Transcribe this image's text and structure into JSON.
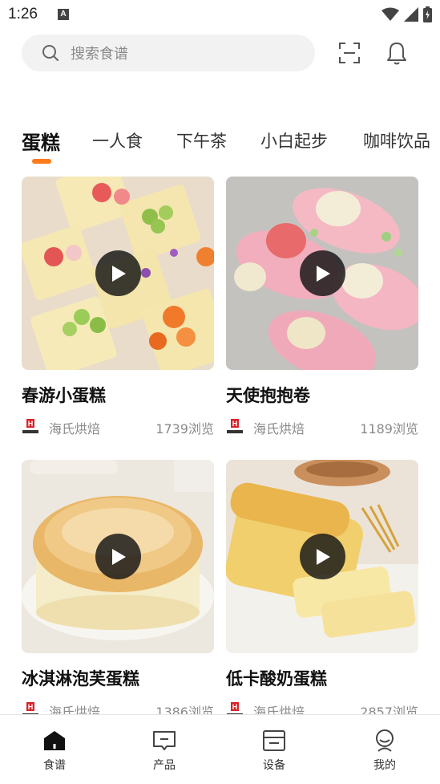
{
  "status_bar": {
    "time": "1:26",
    "notification_badge": "A"
  },
  "search": {
    "placeholder": "搜索食谱"
  },
  "tabs": [
    {
      "label": "蛋糕",
      "active": true
    },
    {
      "label": "一人食",
      "active": false
    },
    {
      "label": "下午茶",
      "active": false
    },
    {
      "label": "小白起步",
      "active": false
    },
    {
      "label": "咖啡饮品",
      "active": false
    }
  ],
  "recipes": [
    {
      "title": "春游小蛋糕",
      "brand": "海氏烘焙",
      "views": "1739浏览"
    },
    {
      "title": "天使抱抱卷",
      "brand": "海氏烘焙",
      "views": "1189浏览"
    },
    {
      "title": "冰淇淋泡芙蛋糕",
      "brand": "海氏烘焙",
      "views": "1386浏览"
    },
    {
      "title": "低卡酸奶蛋糕",
      "brand": "海氏烘焙",
      "views": "2857浏览"
    }
  ],
  "bottom_nav": [
    {
      "label": "食谱",
      "icon": "home-icon",
      "active": true
    },
    {
      "label": "产品",
      "icon": "message-icon",
      "active": false
    },
    {
      "label": "设备",
      "icon": "device-icon",
      "active": false
    },
    {
      "label": "我的",
      "icon": "profile-icon",
      "active": false
    }
  ],
  "colors": {
    "accent": "#ff7a1a",
    "brand_red": "#d8232a"
  }
}
